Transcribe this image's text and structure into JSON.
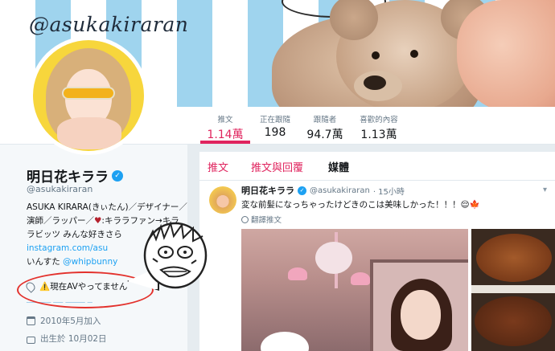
{
  "banner": {
    "handle_text": "@asukakiraran"
  },
  "stats": [
    {
      "label": "推文",
      "value": "1.14萬",
      "active": true
    },
    {
      "label": "正在跟隨",
      "value": "198"
    },
    {
      "label": "跟隨者",
      "value": "94.7萬"
    },
    {
      "label": "喜歡的內容",
      "value": "1.13萬"
    }
  ],
  "profile": {
    "display_name": "明日花キララ",
    "handle": "@asukakiraran",
    "bio_line1": "ASUKA KIRARA(きぃたん)／デザイナー／",
    "bio_line2": "演師／ラッパー／",
    "bio_heart": "♥",
    "bio_line2b": ":キララファン→キラ",
    "bio_line3": "ラビッツ",
    "bio_line3b": " みんな好きさら",
    "bio_line4": "instagram.com/asu",
    "bio_line5a": "いんすた",
    "bio_line5b": "@whipbunny",
    "location": "⚠️現在AVやってません",
    "joined": "2010年5月加入",
    "born": "出生於 10月02日"
  },
  "tabs": {
    "tweets": "推文",
    "replies": "推文與回覆",
    "media": "媒體"
  },
  "tweet": {
    "name": "明日花キララ",
    "handle": "@asukakiraran",
    "time": "· 15小時",
    "text": "変な前髪になっちゃったけどきのこは美味しかった！！！😌🍁",
    "translate": "翻譯推文"
  },
  "colors": {
    "accent": "#e0245e",
    "link": "#1da1f2",
    "annotation": "#e3312c"
  }
}
